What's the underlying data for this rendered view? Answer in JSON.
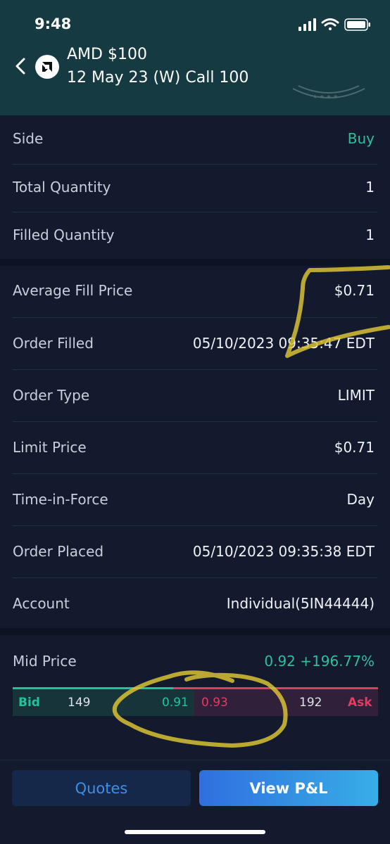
{
  "status_bar": {
    "time": "9:48"
  },
  "header": {
    "title_line1": "AMD $100",
    "title_line2": "12 May 23 (W) Call 100"
  },
  "order": {
    "side": {
      "label": "Side",
      "value": "Buy"
    },
    "total_quantity": {
      "label": "Total Quantity",
      "value": "1"
    },
    "filled_quantity": {
      "label": "Filled Quantity",
      "value": "1"
    },
    "average_fill_price": {
      "label": "Average Fill Price",
      "value": "$0.71"
    },
    "order_filled": {
      "label": "Order Filled",
      "value": "05/10/2023 09:35:47 EDT"
    },
    "order_type": {
      "label": "Order Type",
      "value": "LIMIT"
    },
    "limit_price": {
      "label": "Limit Price",
      "value": "$0.71"
    },
    "time_in_force": {
      "label": "Time-in-Force",
      "value": "Day"
    },
    "order_placed": {
      "label": "Order Placed",
      "value": "05/10/2023 09:35:38 EDT"
    },
    "account": {
      "label": "Account",
      "value": "Individual(5IN44444)"
    }
  },
  "market": {
    "mid_price_label": "Mid Price",
    "mid_price_value": "0.92 +196.77%",
    "bid_label": "Bid",
    "bid_size": "149",
    "bid_price": "0.91",
    "ask_price": "0.93",
    "ask_size": "192",
    "ask_label": "Ask",
    "bid_share": 0.44
  },
  "actions": {
    "quotes_label": "Quotes",
    "view_pnl_label": "View P&L"
  },
  "colors": {
    "header_bg": "#153a42",
    "page_bg": "#131a2d",
    "positive": "#2fbf9b",
    "bid": "#22c39a",
    "ask": "#e23c62",
    "button_primary": "#2f6fe0",
    "annotation": "#d8c234"
  }
}
